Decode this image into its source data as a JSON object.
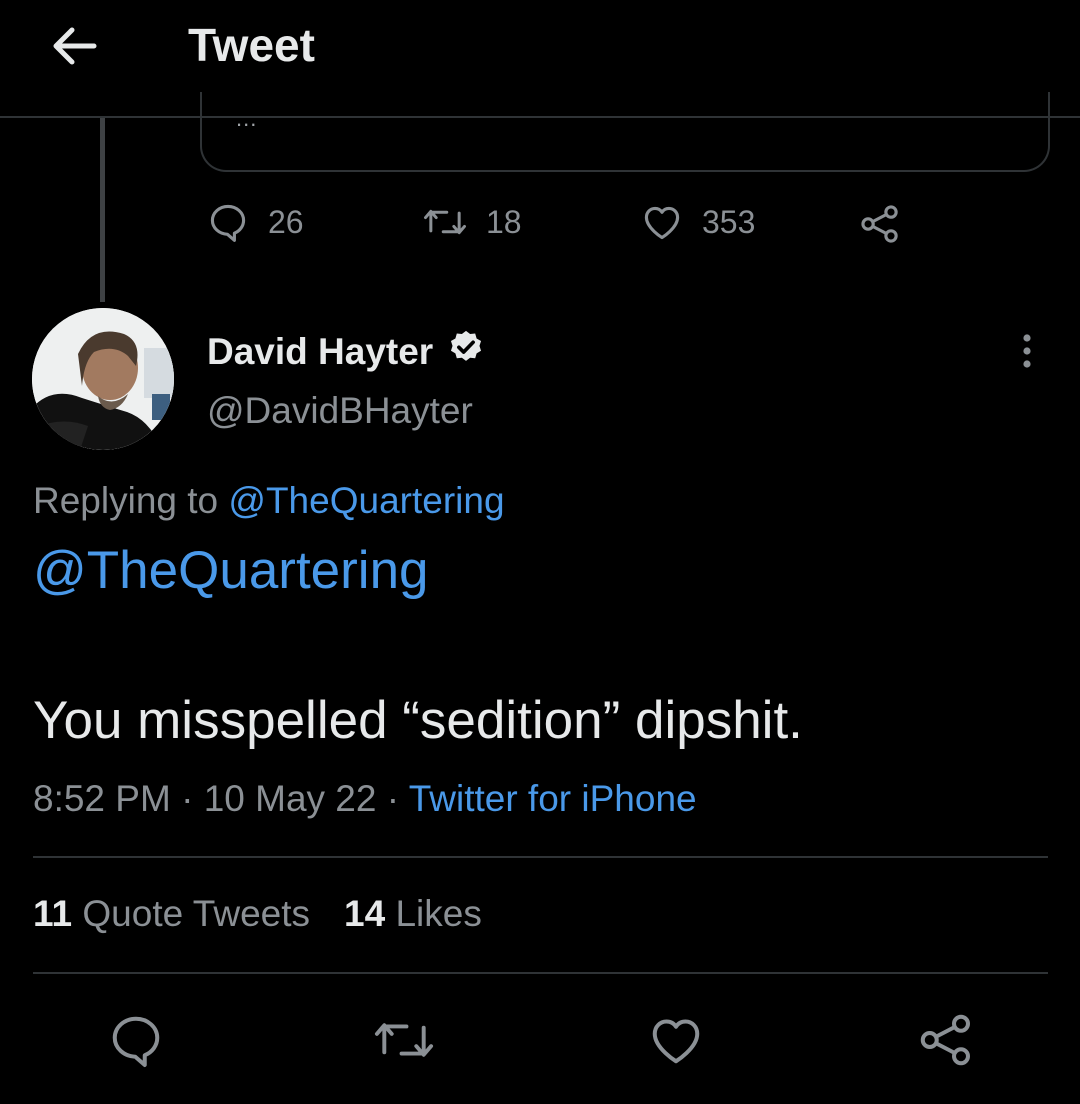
{
  "header": {
    "title": "Tweet"
  },
  "quoted_tweet": {
    "ellipsis": "..."
  },
  "parent_actions": {
    "replies": "26",
    "retweets": "18",
    "likes": "353"
  },
  "author": {
    "name": "David Hayter",
    "handle": "@DavidBHayter"
  },
  "replying": {
    "prefix": "Replying to",
    "target": "@TheQuartering"
  },
  "tweet": {
    "mention": "@TheQuartering",
    "text": "You misspelled “sedition” dipshit.",
    "time": "8:52 PM",
    "date": "10 May 22",
    "separator": " · ",
    "source": "Twitter for iPhone"
  },
  "stats": {
    "quote_count": "11",
    "quote_label": "Quote Tweets",
    "like_count": "14",
    "like_label": "Likes"
  },
  "icons": [
    "back-arrow-icon",
    "reply-icon",
    "retweet-icon",
    "like-icon",
    "share-icon",
    "verified-badge-icon",
    "more-options-icon"
  ],
  "colors": {
    "background": "#000000",
    "link": "#4a99e9",
    "muted": "#8b9095",
    "text": "#e7e9ea",
    "divider": "#2f3336"
  }
}
